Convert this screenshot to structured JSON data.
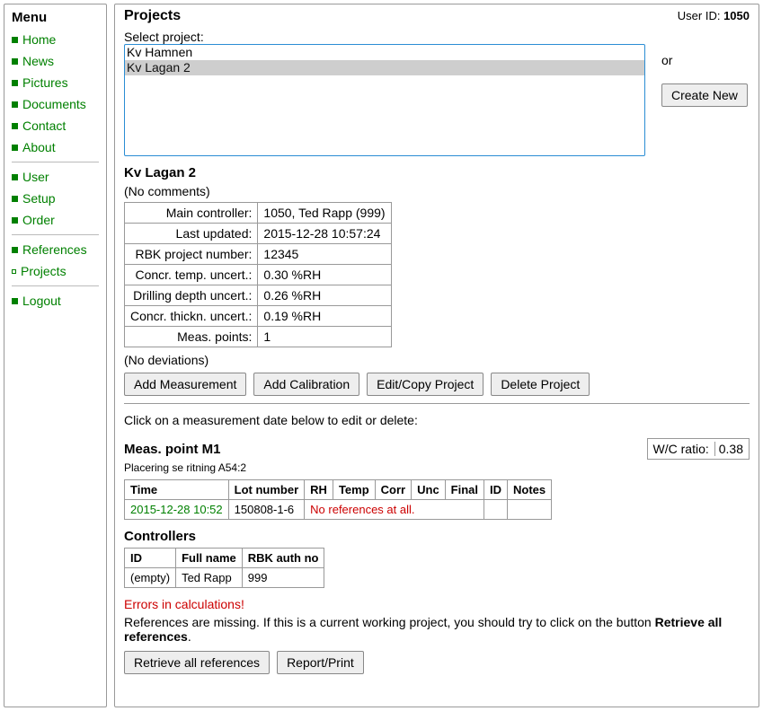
{
  "menu": {
    "title": "Menu",
    "group1": [
      "Home",
      "News",
      "Pictures",
      "Documents",
      "Contact",
      "About"
    ],
    "group2": [
      "User",
      "Setup",
      "Order"
    ],
    "group3": [
      "References",
      "Projects"
    ],
    "group4": [
      "Logout"
    ],
    "active": "Projects"
  },
  "header": {
    "title": "Projects",
    "user_id_label": "User ID:",
    "user_id": "1050"
  },
  "select": {
    "label": "Select project:",
    "options": [
      "Kv Hamnen",
      "Kv Lagan 2"
    ],
    "selected": "Kv Lagan 2",
    "or_text": "or",
    "create_btn": "Create New"
  },
  "project": {
    "name": "Kv Lagan 2",
    "no_comments": "(No comments)",
    "props": [
      [
        "Main controller:",
        "1050, Ted Rapp (999)"
      ],
      [
        "Last updated:",
        "2015-12-28 10:57:24"
      ],
      [
        "RBK project number:",
        "12345"
      ],
      [
        "Concr. temp. uncert.:",
        "0.30 %RH"
      ],
      [
        "Drilling depth uncert.:",
        "0.26 %RH"
      ],
      [
        "Concr. thickn. uncert.:",
        "0.19 %RH"
      ],
      [
        "Meas. points:",
        "1"
      ]
    ],
    "no_deviations": "(No deviations)"
  },
  "buttons": {
    "add_meas": "Add Measurement",
    "add_cal": "Add Calibration",
    "edit_copy": "Edit/Copy Project",
    "delete": "Delete Project",
    "retrieve": "Retrieve all references",
    "report": "Report/Print"
  },
  "instruction": "Click on a measurement date below to edit or delete:",
  "meas_point": {
    "title": "Meas. point M1",
    "sub": "Placering se ritning A54:2",
    "wc_label": "W/C ratio:",
    "wc_value": "0.38",
    "headers": [
      "Time",
      "Lot number",
      "RH",
      "Temp",
      "Corr",
      "Unc",
      "Final",
      "ID",
      "Notes"
    ],
    "row": {
      "time": "2015-12-28 10:52",
      "lot": "150808-1-6",
      "noref": "No references at all."
    }
  },
  "controllers": {
    "title": "Controllers",
    "headers": [
      "ID",
      "Full name",
      "RBK auth no"
    ],
    "row": {
      "id": "(empty)",
      "name": "Ted Rapp",
      "auth": "999"
    }
  },
  "errors": {
    "title": "Errors in calculations!",
    "text1": "References are missing. If this is a current working project, you should try to click on the button",
    "text2": "Retrieve all references",
    "text3": "."
  }
}
